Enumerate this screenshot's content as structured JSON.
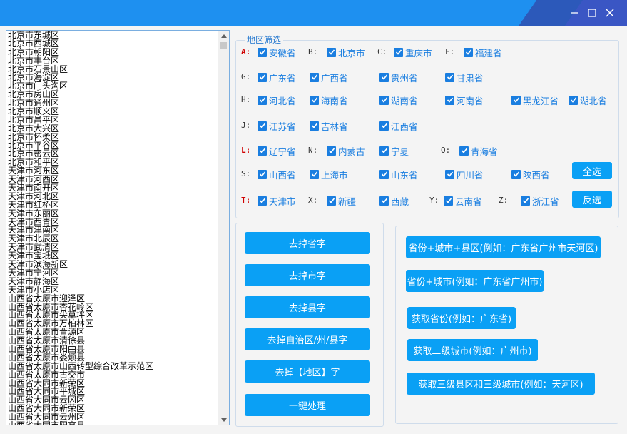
{
  "window": {
    "minimize_icon": "minimize-icon",
    "maximize_icon": "maximize-icon",
    "close_icon": "close-icon"
  },
  "list": {
    "items": [
      "北京市东城区",
      "北京市西城区",
      "北京市朝阳区",
      "北京市丰台区",
      "北京市石景山区",
      "北京市海淀区",
      "北京市门头沟区",
      "北京市房山区",
      "北京市通州区",
      "北京市顺义区",
      "北京市昌平区",
      "北京市大兴区",
      "北京市怀柔区",
      "北京市平谷区",
      "北京市密云区",
      "北京市和平区",
      "天津市河东区",
      "天津市河西区",
      "天津市南开区",
      "天津市河北区",
      "天津市红桥区",
      "天津市东丽区",
      "天津市西青区",
      "天津市津南区",
      "天津市北辰区",
      "天津市武清区",
      "天津市宝坻区",
      "天津市滨海新区",
      "天津市宁河区",
      "天津市静海区",
      "天津市小店区",
      "山西省太原市迎泽区",
      "山西省太原市杏花岭区",
      "山西省太原市尖草坪区",
      "山西省太原市万柏林区",
      "山西省太原市晋源区",
      "山西省太原市清徐县",
      "山西省太原市阳曲县",
      "山西省太原市娄烦县",
      "山西省太原市山西转型综合改革示范区",
      "山西省太原市古交市",
      "山西省大同市新荣区",
      "山西省大同市平城区",
      "山西省大同市云冈区",
      "山西省大同市新荣区",
      "山西省大同市云州区",
      "山西省大同市阳高县"
    ]
  },
  "region": {
    "legend": "地区筛选",
    "letters": [
      "A:",
      "B:",
      "C:",
      "F:",
      "G:",
      "H:",
      "J:",
      "L:",
      "N:",
      "Q:",
      "S:",
      "T:",
      "X:",
      "Y:",
      "Z:"
    ],
    "provinces": [
      "安徽省",
      "北京市",
      "重庆市",
      "福建省",
      "广东省",
      "广西省",
      "贵州省",
      "甘肃省",
      "河北省",
      "海南省",
      "湖南省",
      "河南省",
      "黑龙江省",
      "湖北省",
      "江苏省",
      "吉林省",
      "江西省",
      "辽宁省",
      "内蒙古",
      "宁夏",
      "青海省",
      "山西省",
      "上海市",
      "山东省",
      "四川省",
      "陕西省",
      "天津市",
      "新疆",
      "西藏",
      "云南省",
      "浙江省"
    ],
    "select_all": "全选",
    "invert": "反选"
  },
  "actions": {
    "left": [
      "去掉省字",
      "去掉市字",
      "去掉县字",
      "去掉自治区/州/县字",
      "去掉【地区】字",
      "一键处理"
    ],
    "right": [
      "省份+城市+县区(例如：广东省广州市天河区)",
      "省份+城市(例如：广东省广州市)",
      "获取省份(例如：广东省)",
      "获取二级城市(例如：广州市)",
      "获取三级县区和三级城市(例如：天河区)"
    ]
  }
}
